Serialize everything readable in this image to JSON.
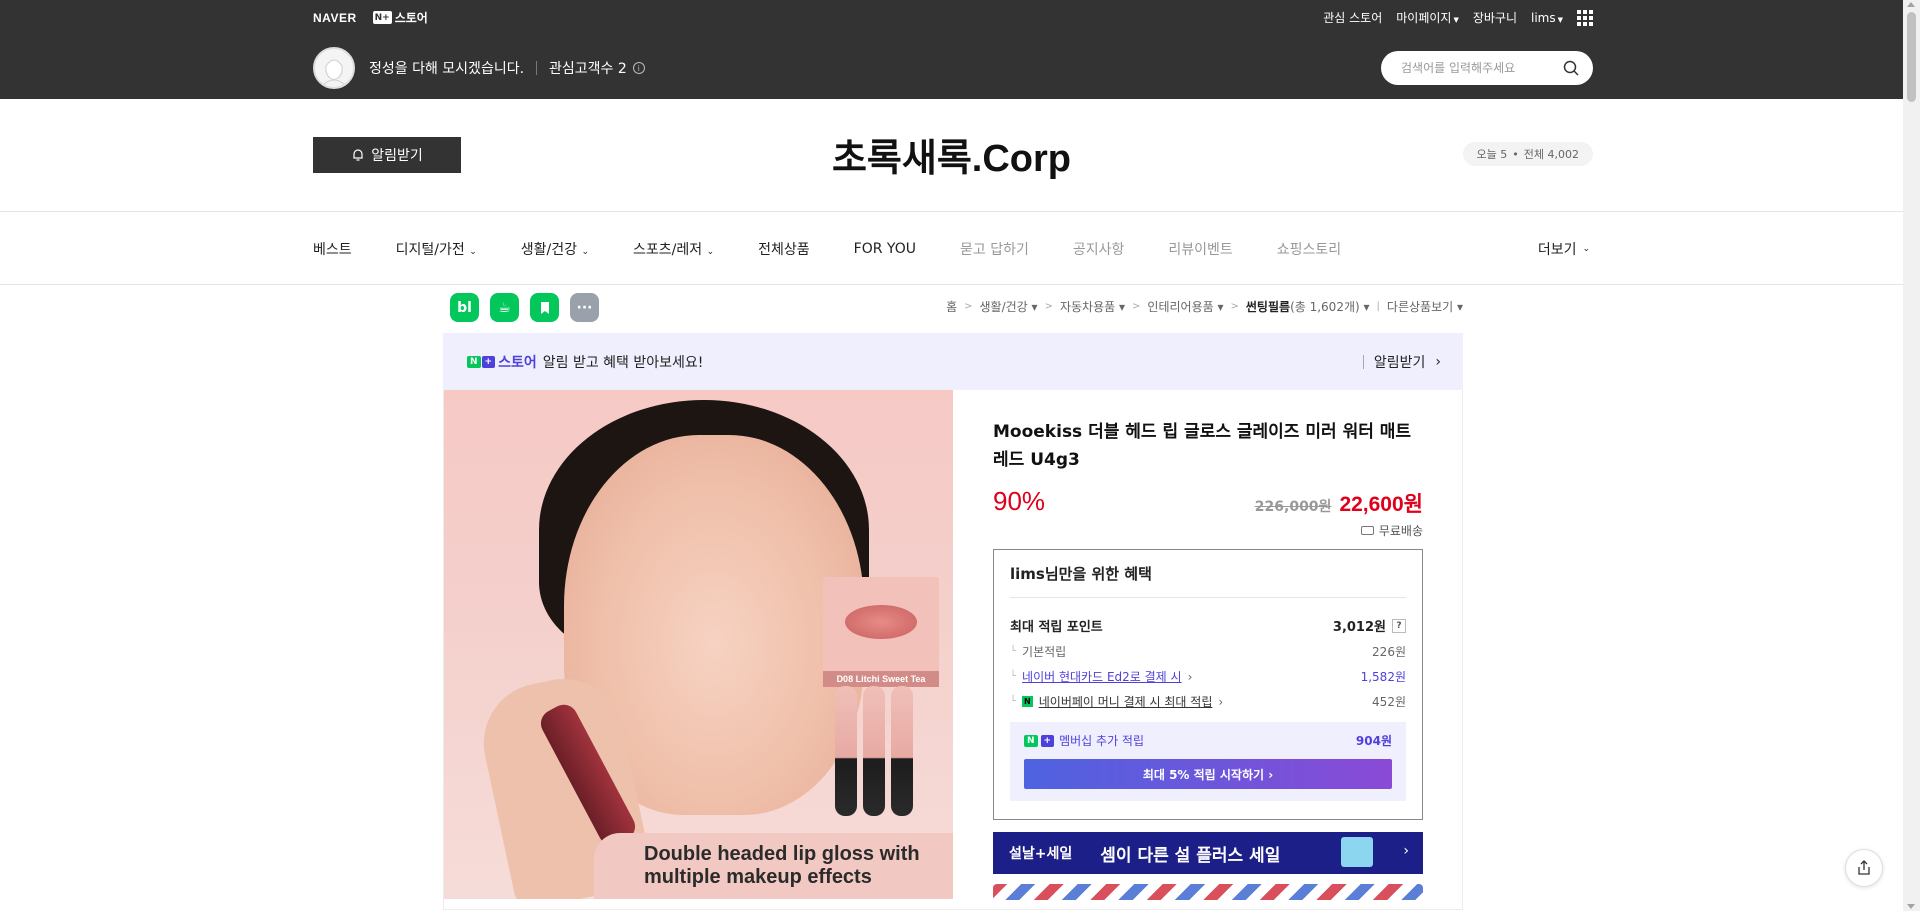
{
  "gnb": {
    "naver": "NAVER",
    "nplus_box": "N+",
    "nplus_store": "스토어",
    "links": [
      "관심 스토어",
      "마이페이지",
      "장바구니",
      "lims"
    ]
  },
  "store": {
    "greeting": "정성을 다해 모시겠습니다.",
    "interest_label": "관심고객수 2",
    "search_placeholder": "검색어를 입력해주세요",
    "notify_label": "알림받기",
    "name": "초록새록.Corp",
    "visits_today": "오늘 5",
    "visits_total": "전체 4,002"
  },
  "categories": {
    "items": [
      "베스트",
      "디지털/가전",
      "생활/건강",
      "스포츠/레저",
      "전체상품",
      "FOR YOU",
      "묻고 답하기",
      "공지사항",
      "리뷰이벤트",
      "쇼핑스토리"
    ],
    "more": "더보기"
  },
  "breadcrumb": {
    "items": [
      "홈",
      "생활/건강",
      "자동차용품",
      "인테리어용품"
    ],
    "current": "썬팅필름",
    "count": "(총 1,602개)",
    "other": "다른상품보기"
  },
  "promo": {
    "store": "스토어",
    "text": "알림 받고 혜택 받아보세요!",
    "action": "알림받기"
  },
  "product": {
    "name": "Mooekiss 더블 헤드 립 글로스 글레이즈 미러 워터 매트 레드 U4g3",
    "discount": "90%",
    "original_price": "226,000원",
    "sale_price": "22,600원",
    "shipping": "무료배송",
    "image_swatch_label": "D08 Litchi Sweet Tea",
    "image_caption_1": "Double headed lip gloss with",
    "image_caption_2": "multiple makeup effects"
  },
  "benefits": {
    "title": "lims님만을 위한 혜택",
    "max_points_label": "최대 적립 포인트",
    "max_points": "3,012원",
    "help": "?",
    "basic_label": "기본적립",
    "basic_value": "226원",
    "card_label": "네이버 현대카드 Ed2로 결제 시",
    "card_value": "1,582원",
    "npay_icon": "N",
    "npay_label": "네이버페이 머니 결제 시 최대 적립",
    "npay_value": "452원",
    "member_label": "멤버십 추가 적립",
    "member_value": "904원",
    "member_button": "최대 5% 적립 시작하기"
  },
  "sale_banner": {
    "left": "설날+세일",
    "main": "셈이 다른 설 플러스 세일"
  }
}
